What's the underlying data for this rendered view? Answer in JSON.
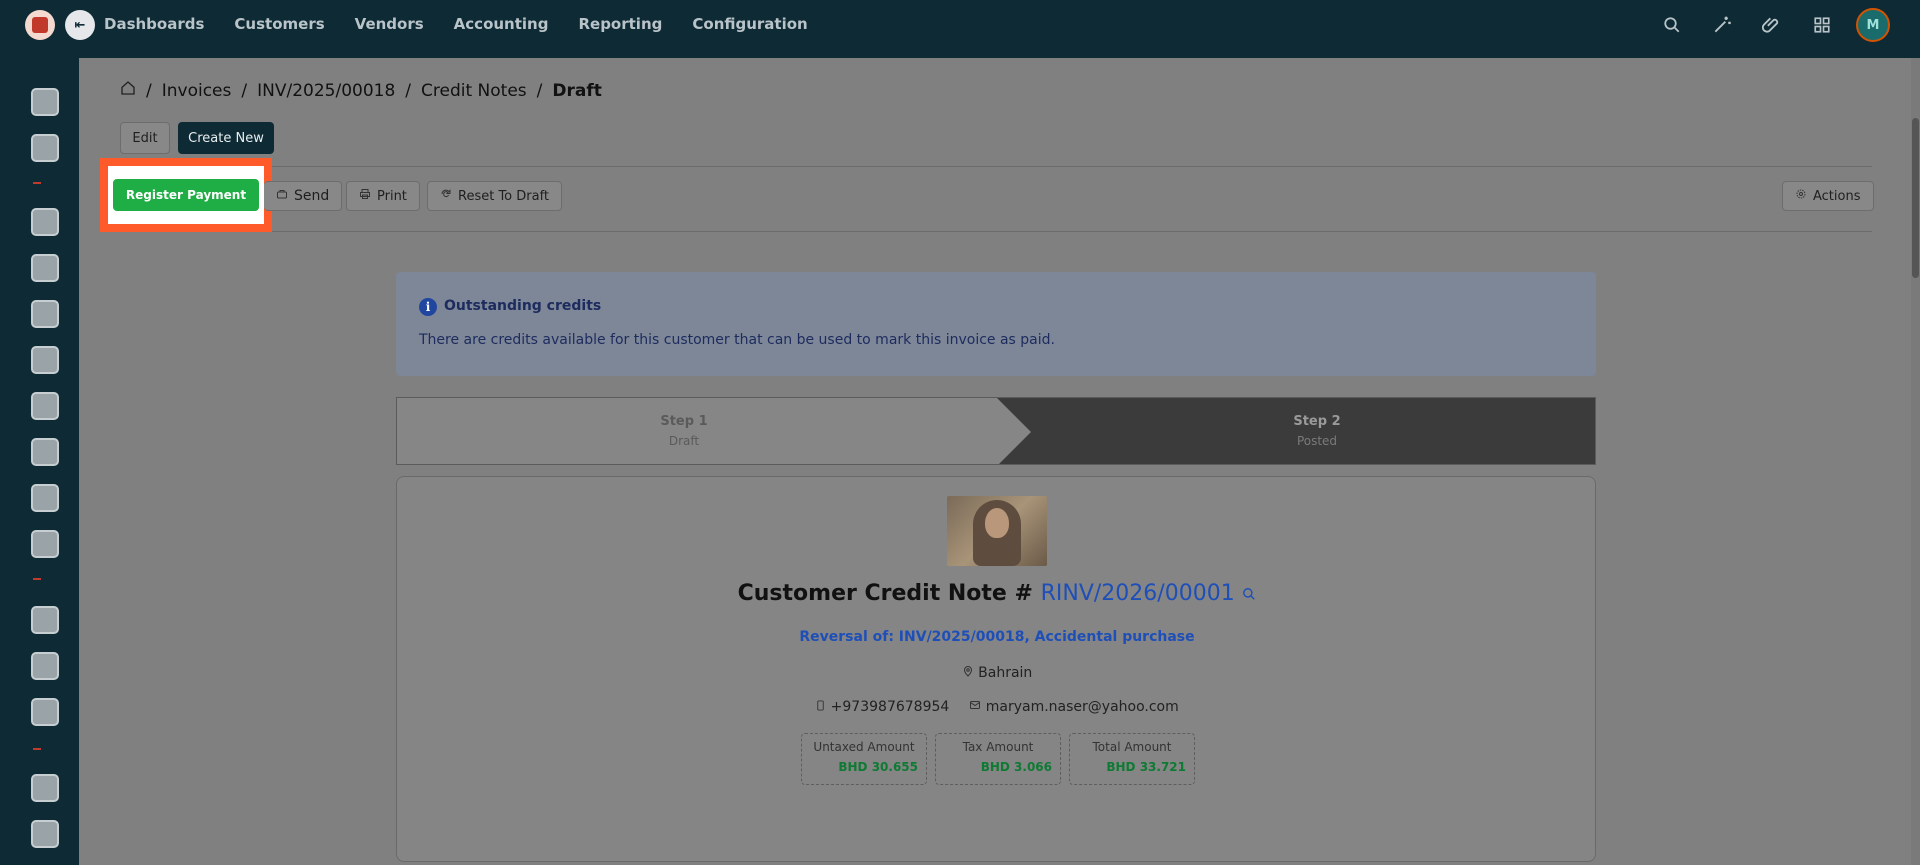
{
  "topbar": {
    "nav": [
      "Dashboards",
      "Customers",
      "Vendors",
      "Accounting",
      "Reporting",
      "Configuration"
    ],
    "icons": [
      "search-icon",
      "magic-wand-icon",
      "paperclip-icon",
      "apps-grid-icon",
      "user-avatar"
    ]
  },
  "breadcrumb": {
    "items": [
      "Invoices",
      "INV/2025/00018",
      "Credit Notes"
    ],
    "current": "Draft"
  },
  "buttons": {
    "edit": "Edit",
    "create_new": "Create New",
    "register_payment": "Register Payment",
    "send": "Send",
    "print": "Print",
    "reset_to_draft": "Reset To Draft",
    "actions": "Actions"
  },
  "alert": {
    "title": "Outstanding credits",
    "text": "There are credits available for this customer that can be used to mark this invoice as paid."
  },
  "steps": [
    {
      "label": "Step 1",
      "sub": "Draft"
    },
    {
      "label": "Step 2",
      "sub": "Posted"
    }
  ],
  "document": {
    "title_prefix": "Customer Credit Note #",
    "number": "RINV/2026/00001",
    "reversal": "Reversal of: INV/2025/00018, Accidental purchase",
    "country": "Bahrain",
    "phone": "+973987678954",
    "email": "maryam.naser@yahoo.com",
    "amounts": [
      {
        "label": "Untaxed Amount",
        "value": "BHD 30.655"
      },
      {
        "label": "Tax Amount",
        "value": "BHD 3.066"
      },
      {
        "label": "Total Amount",
        "value": "BHD 33.721"
      }
    ]
  },
  "colors": {
    "topbar": "#0e2a35",
    "register": "#1fae45",
    "highlight": "#ff5a2a",
    "link": "#1e4fb8",
    "amount": "#0f7a33"
  }
}
